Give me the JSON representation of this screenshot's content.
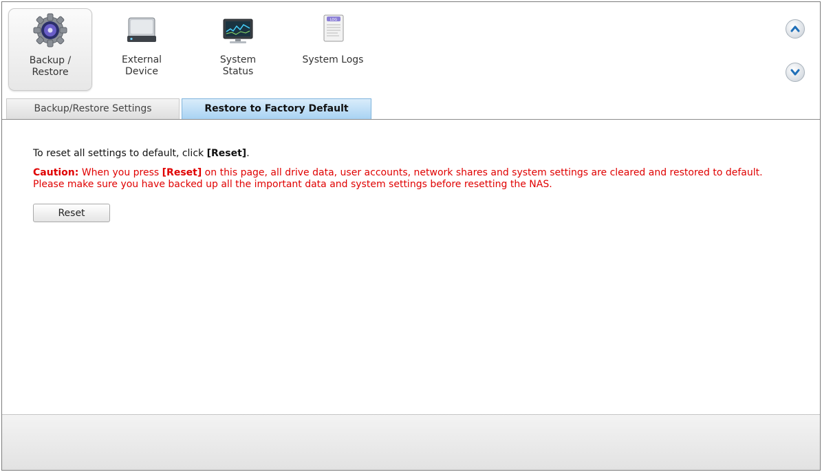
{
  "toolbar": {
    "items": [
      {
        "label": "Backup /\nRestore",
        "icon": "gear-disc-icon"
      },
      {
        "label": "External\nDevice",
        "icon": "hard-drive-icon"
      },
      {
        "label": "System\nStatus",
        "icon": "monitor-icon"
      },
      {
        "label": "System Logs",
        "icon": "log-document-icon"
      }
    ],
    "scroll_up": "chevron-up-icon",
    "scroll_down": "chevron-down-icon"
  },
  "tabs": [
    {
      "label": "Backup/Restore Settings",
      "active": false
    },
    {
      "label": "Restore to Factory Default",
      "active": true
    }
  ],
  "content": {
    "intro_text": "To reset all settings to default, click ",
    "intro_bold": "[Reset]",
    "intro_end": ".",
    "caution_label": "Caution:",
    "caution_part1": " When you press ",
    "caution_bold": "[Reset]",
    "caution_part2": " on this page, all drive data, user accounts, network shares and system settings are cleared and restored to default. Please make sure you have backed up all the important data and system settings before resetting the NAS.",
    "reset_button": "Reset"
  },
  "colors": {
    "caution": "#e00000",
    "active_tab": "#a9d3f3"
  }
}
